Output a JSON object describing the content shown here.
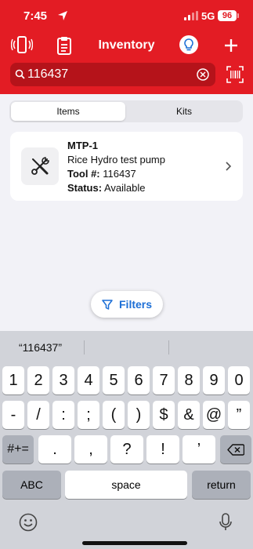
{
  "status_bar": {
    "time": "7:45",
    "network": "5G",
    "battery": "96"
  },
  "nav": {
    "title": "Inventory"
  },
  "search": {
    "value": "116437",
    "placeholder": ""
  },
  "segments": [
    "Items",
    "Kits"
  ],
  "item": {
    "name": "MTP-1",
    "description": "Rice Hydro test pump",
    "tool_label": "Tool #:",
    "tool_number": "116437",
    "status_label": "Status:",
    "status_value": "Available"
  },
  "filters_label": "Filters",
  "keyboard": {
    "suggestion": "“116437”",
    "row1": [
      "1",
      "2",
      "3",
      "4",
      "5",
      "6",
      "7",
      "8",
      "9",
      "0"
    ],
    "row2": [
      "-",
      "/",
      ":",
      ";",
      "(",
      ")",
      "$",
      "&",
      "@",
      "”"
    ],
    "shift_label": "#+=",
    "row3": [
      ".",
      ",",
      "?",
      "!",
      "’"
    ],
    "abc": "ABC",
    "space": "space",
    "return": "return"
  },
  "colors": {
    "brand": "#e31c24",
    "accent": "#1d6fd6"
  }
}
